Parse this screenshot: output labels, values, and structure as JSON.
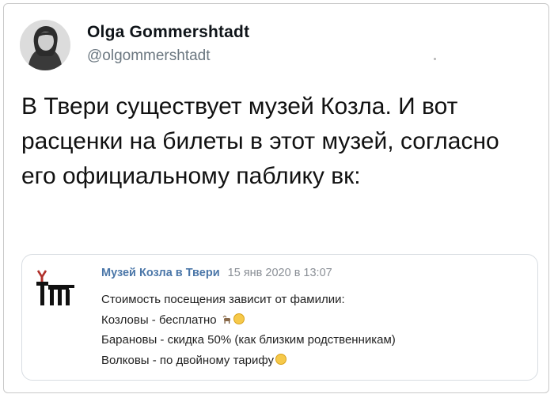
{
  "author": {
    "name": "Olga Gommershtadt",
    "handle": "@olgommershtadt"
  },
  "tweet": {
    "text": "В Твери существует музей Козла. И вот расценки на билеты в этот музей, согласно его официальному паблику вк:"
  },
  "quote": {
    "group_name": "Музей Козла в Твери",
    "timestamp": "15 янв 2020 в 13:07",
    "lines": [
      "Стоимость посещения зависит от фамилии:",
      "Козловы - бесплатно",
      "Барановы - скидка 50% (как близким родственникам)",
      "Волковы - по двойному тарифу"
    ],
    "emoji": [
      "goat-emoji",
      "smile-emoji"
    ]
  },
  "colors": {
    "group_link": "#4a76a8",
    "handle": "#6b7780",
    "card_border": "#d8dde2"
  }
}
